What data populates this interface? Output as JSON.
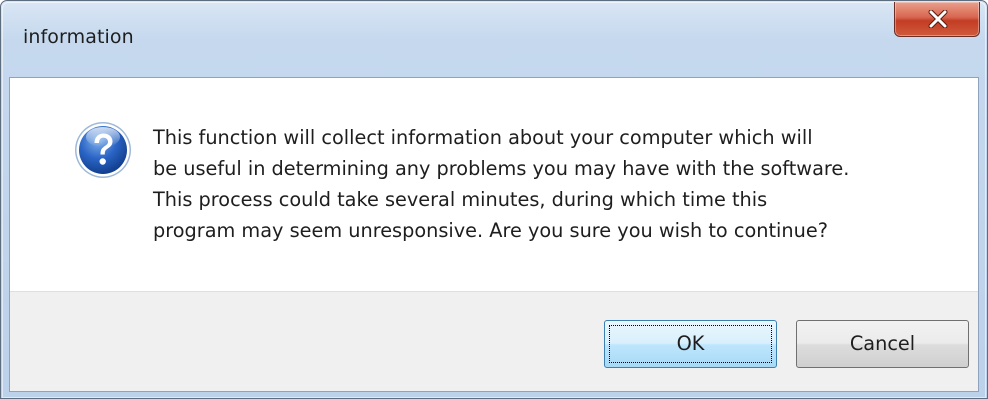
{
  "window": {
    "title": "information"
  },
  "dialog": {
    "icon": "question-icon",
    "message": "This function will collect information about your computer which will\nbe useful in determining any problems you may have with the software.\nThis process could take several minutes, during which time this\nprogram may seem unresponsive.  Are you sure you wish to continue?"
  },
  "buttons": {
    "ok_label": "OK",
    "cancel_label": "Cancel"
  },
  "colors": {
    "titlebar": "#c5d8ee",
    "close_button": "#c33d24",
    "button_area": "#f0f0f0",
    "ok_default_border": "#3c7fb1"
  }
}
